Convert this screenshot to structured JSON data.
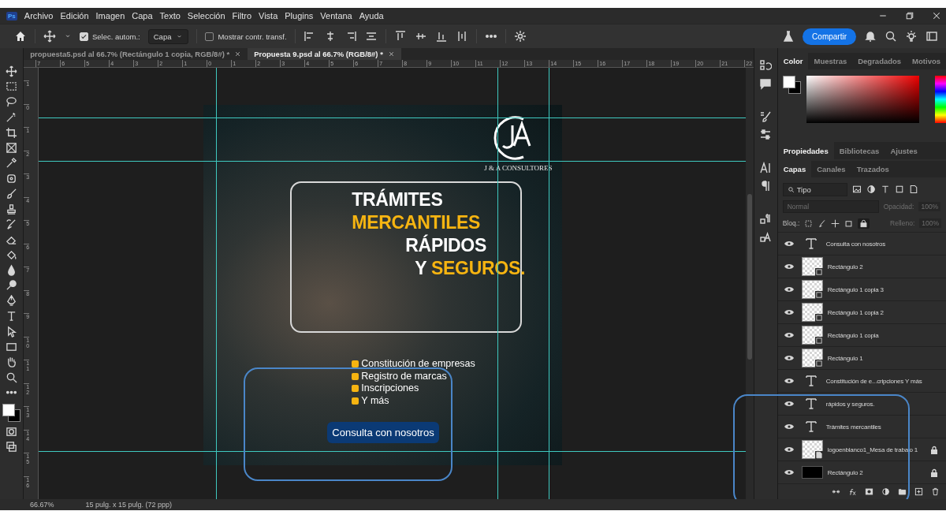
{
  "app_logo": "Ps",
  "menu_bar": {
    "items": [
      "Archivo",
      "Edición",
      "Imagen",
      "Capa",
      "Texto",
      "Selección",
      "Filtro",
      "Vista",
      "Plugins",
      "Ventana",
      "Ayuda"
    ]
  },
  "options_bar": {
    "auto_select": {
      "label": "Selec. autom.:",
      "checked": true
    },
    "target": "Capa",
    "transform_controls": {
      "label": "Mostrar contr. transf.",
      "checked": false
    },
    "share_button": "Compartir"
  },
  "document_tabs": [
    {
      "title": "propuesta5.psd al 66.7% (Rectángulo 1 copia, RGB/8#) *",
      "selected": false
    },
    {
      "title": "Propuesta 9.psd al 66.7% (RGB/8#) *",
      "selected": true
    }
  ],
  "horizontal_ruler": [
    "7",
    "6",
    "5",
    "4",
    "3",
    "2",
    "1",
    "0",
    "1",
    "2",
    "3",
    "4",
    "5",
    "6",
    "7",
    "8",
    "9",
    "10",
    "11",
    "12",
    "13",
    "14",
    "15",
    "16",
    "17",
    "18",
    "19",
    "20",
    "21",
    "22"
  ],
  "vertical_ruler": [
    "1",
    "0",
    "1",
    "2",
    "3",
    "4",
    "5",
    "6",
    "7",
    "8",
    "9",
    "10",
    "11",
    "12",
    "13",
    "14",
    "15",
    "16"
  ],
  "artwork": {
    "logo_caption": "J & A CONSULTORES",
    "headline": [
      [
        {
          "text": "TRÁMITES",
          "accent": false
        }
      ],
      [
        {
          "text": "MERCANTILES",
          "accent": true
        }
      ],
      [
        {
          "text": "RÁPIDOS",
          "accent": false
        }
      ],
      [
        {
          "text": "Y ",
          "accent": false
        },
        {
          "text": "SEGUROS.",
          "accent": true
        }
      ]
    ],
    "services": [
      "Constitución de empresas",
      "Registro de marcas",
      "Inscripciones",
      "Y más"
    ],
    "cta_button": "Consulta con nosotros"
  },
  "color_panel": {
    "tabs": [
      {
        "label": "Color",
        "selected": true
      },
      {
        "label": "Muestras",
        "selected": false
      },
      {
        "label": "Degradados",
        "selected": false
      },
      {
        "label": "Motivos",
        "selected": false
      }
    ]
  },
  "properties_tabs": [
    {
      "label": "Propiedades",
      "selected": true
    },
    {
      "label": "Bibliotecas",
      "selected": false
    },
    {
      "label": "Ajustes",
      "selected": false
    }
  ],
  "layers_panel": {
    "tabs": [
      {
        "label": "Capas",
        "selected": true
      },
      {
        "label": "Canales",
        "selected": false
      },
      {
        "label": "Trazados",
        "selected": false
      }
    ],
    "filter": "Tipo",
    "blend_mode": "Normal",
    "opacity_label": "Opacidad:",
    "opacity": "100%",
    "lock_label": "Bloq.:",
    "fill_label": "Relleno:",
    "fill": "100%",
    "layers": [
      {
        "name": "Consulta con nosotros",
        "kind": "text",
        "visible": true,
        "locked": false
      },
      {
        "name": "Rectángulo 2",
        "kind": "shape",
        "visible": true,
        "locked": false
      },
      {
        "name": "Rectángulo 1 copia 3",
        "kind": "shape",
        "visible": true,
        "locked": false
      },
      {
        "name": "Rectángulo 1 copia 2",
        "kind": "shape",
        "visible": true,
        "locked": false
      },
      {
        "name": "Rectángulo 1 copia",
        "kind": "shape",
        "visible": true,
        "locked": false
      },
      {
        "name": "Rectángulo 1",
        "kind": "shape",
        "visible": true,
        "locked": false
      },
      {
        "name": "Constitución de e...cripciones Y más",
        "kind": "text",
        "visible": true,
        "locked": false
      },
      {
        "name": "rápidos   y seguros.",
        "kind": "text",
        "visible": true,
        "locked": false
      },
      {
        "name": "Trámites  mercantiles",
        "kind": "text",
        "visible": true,
        "locked": false
      },
      {
        "name": "logoenblanco1_Mesa de trabajo 1",
        "kind": "smart",
        "visible": true,
        "locked": true
      },
      {
        "name": "Rectángulo 2",
        "kind": "fill",
        "visible": true,
        "locked": true
      }
    ]
  },
  "status_bar": {
    "zoom": "66.67%",
    "document_size": "15 pulg. x 15 pulg. (72 ppp)"
  }
}
